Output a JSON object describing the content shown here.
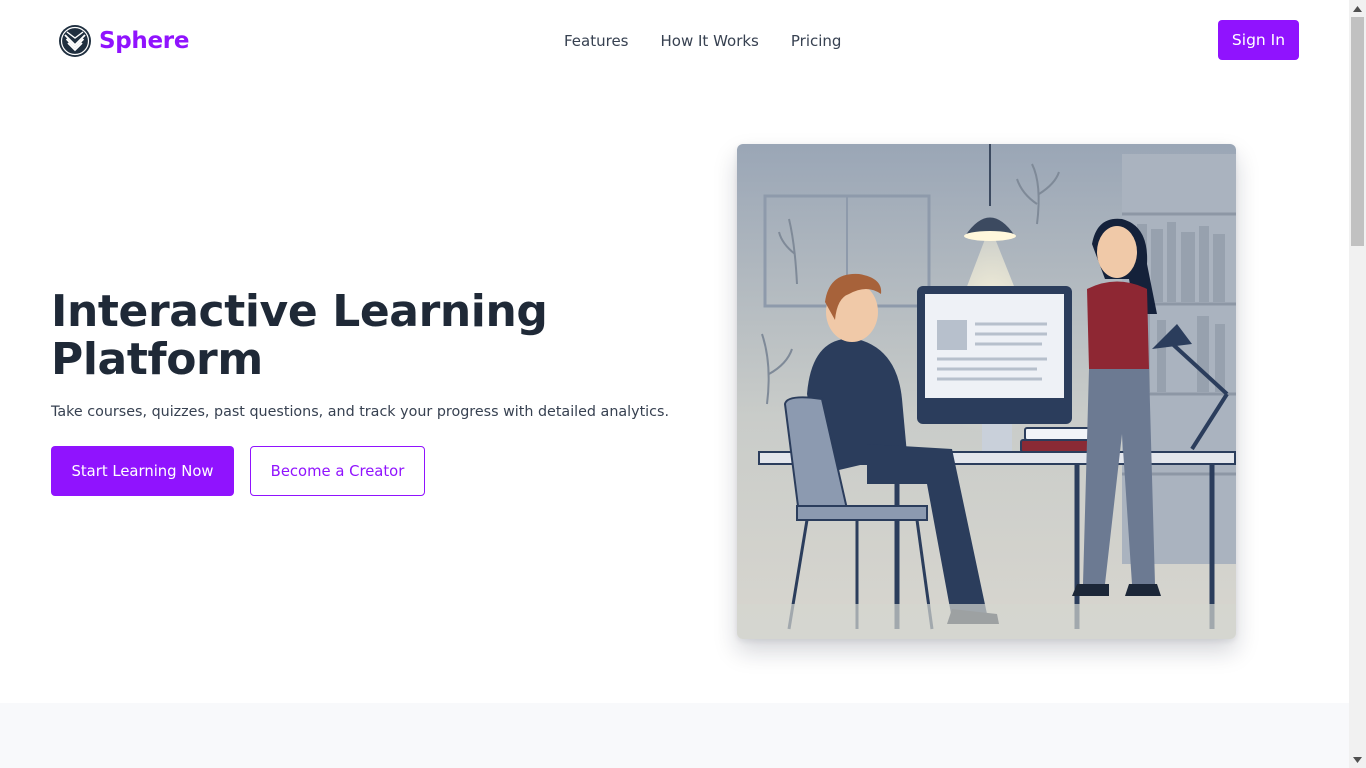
{
  "header": {
    "brand": "Sphere",
    "logo_icon": "sphere-logo-icon",
    "nav": [
      {
        "label": "Features"
      },
      {
        "label": "How It Works"
      },
      {
        "label": "Pricing"
      }
    ],
    "signin_label": "Sign In"
  },
  "hero": {
    "title": "Interactive Learning Platform",
    "subtitle": "Take courses, quizzes, past questions, and track your progress with detailed analytics.",
    "primary_cta": "Start Learning Now",
    "secondary_cta": "Become a Creator",
    "illustration": "two-people-at-computer-illustration"
  },
  "colors": {
    "brand": "#9013fe",
    "heading": "#1f2937",
    "body_text": "#374151",
    "section_bg": "#f8f9fb"
  }
}
